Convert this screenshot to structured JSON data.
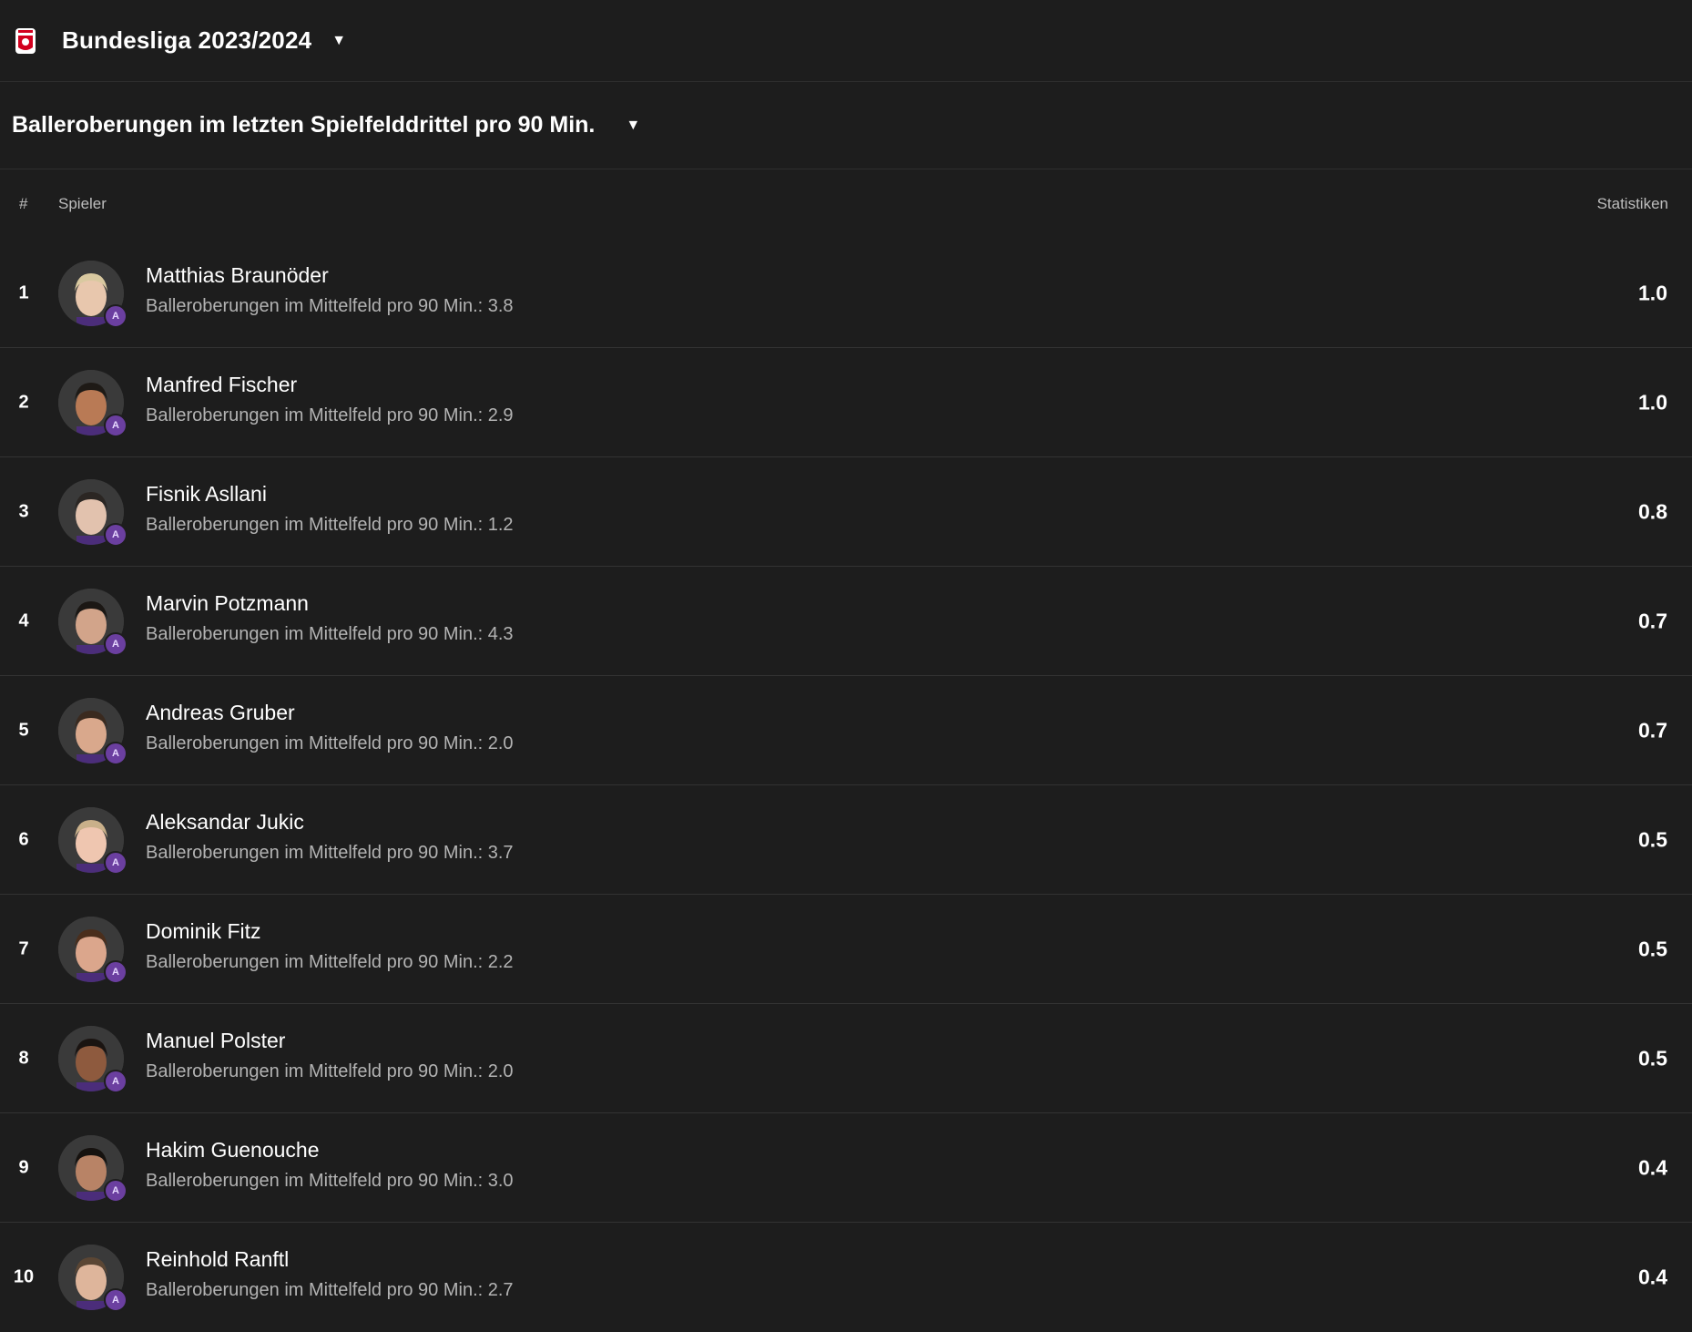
{
  "header": {
    "league_title": "Bundesliga 2023/2024",
    "logo_icon": "bundesliga-logo-icon",
    "caret_icon": "chevron-down-icon"
  },
  "stat_selector": {
    "title": "Balleroberungen im letzten Spielfelddrittel pro 90 Min.",
    "caret_icon": "chevron-down-icon"
  },
  "table": {
    "col_rank": "#",
    "col_player": "Spieler",
    "col_stats": "Statistiken",
    "rows": [
      {
        "rank": "1",
        "name": "Matthias Braunöder",
        "sub": "Balleroberungen im Mittelfeld pro 90 Min.: 3.8",
        "value": "1.0",
        "hair": "#d9c9a0",
        "skin": "#e8c7ad"
      },
      {
        "rank": "2",
        "name": "Manfred Fischer",
        "sub": "Balleroberungen im Mittelfeld pro 90 Min.: 2.9",
        "value": "1.0",
        "hair": "#1e1a16",
        "skin": "#b97a55"
      },
      {
        "rank": "3",
        "name": "Fisnik Asllani",
        "sub": "Balleroberungen im Mittelfeld pro 90 Min.: 1.2",
        "value": "0.8",
        "hair": "#2b2623",
        "skin": "#e2c2ae"
      },
      {
        "rank": "4",
        "name": "Marvin Potzmann",
        "sub": "Balleroberungen im Mittelfeld pro 90 Min.: 4.3",
        "value": "0.7",
        "hair": "#1b1714",
        "skin": "#d2a48a"
      },
      {
        "rank": "5",
        "name": "Andreas Gruber",
        "sub": "Balleroberungen im Mittelfeld pro 90 Min.: 2.0",
        "value": "0.7",
        "hair": "#3a2a1f",
        "skin": "#d9a88c"
      },
      {
        "rank": "6",
        "name": "Aleksandar Jukic",
        "sub": "Balleroberungen im Mittelfeld pro 90 Min.: 3.7",
        "value": "0.5",
        "hair": "#c9b08a",
        "skin": "#efc6b0"
      },
      {
        "rank": "7",
        "name": "Dominik Fitz",
        "sub": "Balleroberungen im Mittelfeld pro 90 Min.: 2.2",
        "value": "0.5",
        "hair": "#4a2e1c",
        "skin": "#dba68c"
      },
      {
        "rank": "8",
        "name": "Manuel Polster",
        "sub": "Balleroberungen im Mittelfeld pro 90 Min.: 2.0",
        "value": "0.5",
        "hair": "#1a1411",
        "skin": "#8e5a3e"
      },
      {
        "rank": "9",
        "name": "Hakim Guenouche",
        "sub": "Balleroberungen im Mittelfeld pro 90 Min.: 3.0",
        "value": "0.4",
        "hair": "#16120f",
        "skin": "#b88366"
      },
      {
        "rank": "10",
        "name": "Reinhold Ranftl",
        "sub": "Balleroberungen im Mittelfeld pro 90 Min.: 2.7",
        "value": "0.4",
        "hair": "#5b4634",
        "skin": "#deb59b"
      }
    ]
  }
}
